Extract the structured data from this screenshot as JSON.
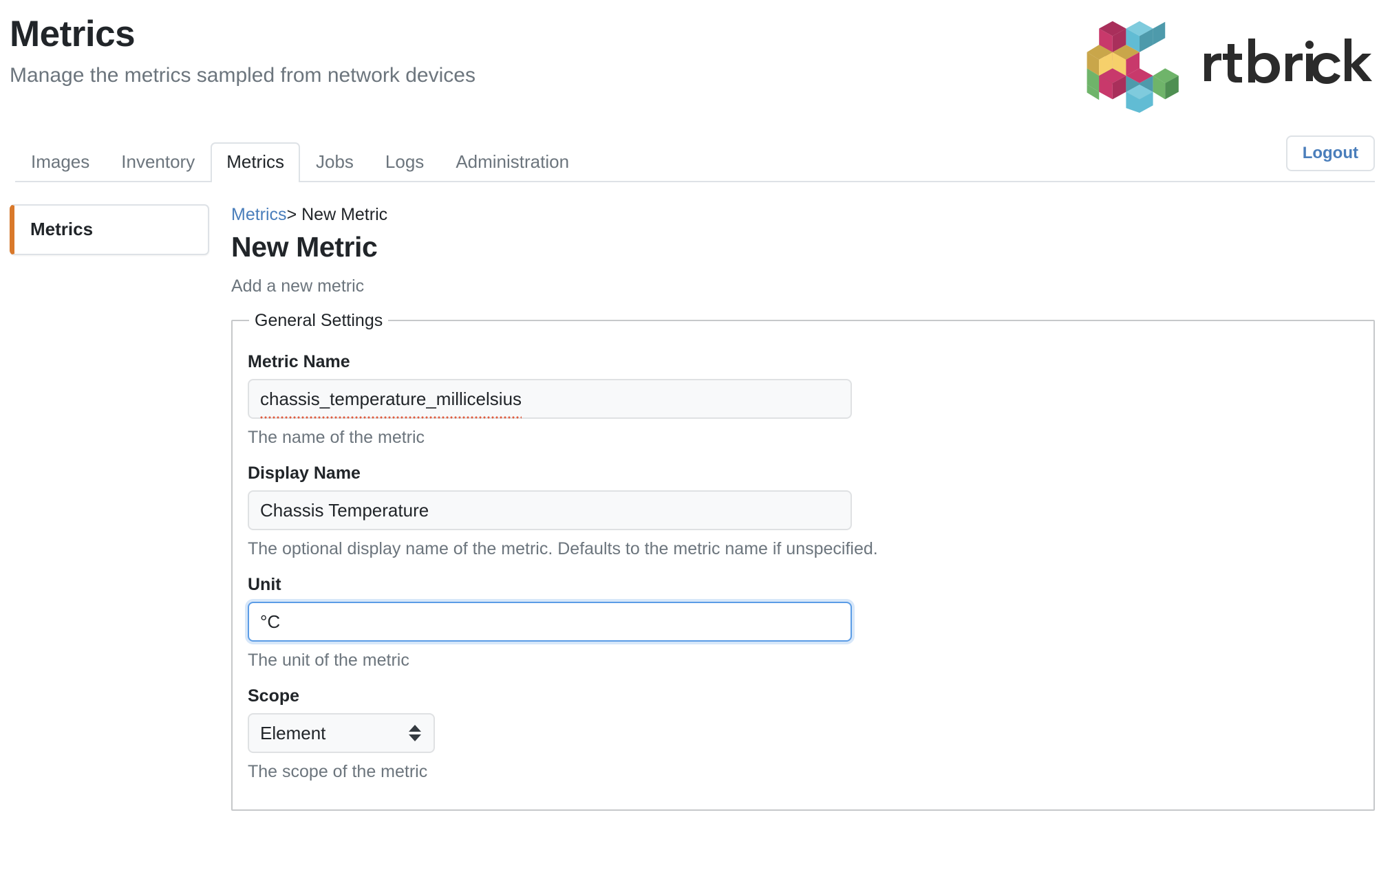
{
  "header": {
    "title": "Metrics",
    "subtitle": "Manage the metrics sampled from network devices",
    "brand_name": "rtbrick",
    "brand_colors": {
      "magenta": "#c8396b",
      "dark_magenta": "#a92f5b",
      "cyan": "#61bcd4",
      "teal": "#4e9aab",
      "gold": "#c9a64a",
      "yellow": "#f6d06b",
      "green": "#6fb46a",
      "dark_green": "#4e8f52",
      "wordmark": "#2b2b2b"
    }
  },
  "nav": {
    "tabs": [
      {
        "label": "Images",
        "active": false
      },
      {
        "label": "Inventory",
        "active": false
      },
      {
        "label": "Metrics",
        "active": true
      },
      {
        "label": "Jobs",
        "active": false
      },
      {
        "label": "Logs",
        "active": false
      },
      {
        "label": "Administration",
        "active": false
      }
    ],
    "logout_label": "Logout",
    "logout_color": "#4a7ebb"
  },
  "sidebar": {
    "items": [
      {
        "label": "Metrics",
        "active": true,
        "accent": "#d9792b"
      }
    ]
  },
  "breadcrumb": {
    "root_label": "Metrics",
    "separator": ">",
    "current_label": "New Metric"
  },
  "page": {
    "title": "New Metric",
    "description": "Add a new metric"
  },
  "form": {
    "legend": "General Settings",
    "fields": [
      {
        "id": "metric-name",
        "label": "Metric Name",
        "value": "chassis_temperature_millicelsius",
        "placeholder": "",
        "help": "The name of the metric",
        "type": "text",
        "focused": false,
        "spellcheck_error": true
      },
      {
        "id": "display-name",
        "label": "Display Name",
        "value": "Chassis Temperature",
        "placeholder": "",
        "help": "The optional display name of the metric. Defaults to the metric name if unspecified.",
        "type": "text",
        "focused": false,
        "spellcheck_error": false
      },
      {
        "id": "unit",
        "label": "Unit",
        "value": "°C",
        "placeholder": "",
        "help": "The unit of the metric",
        "type": "text",
        "focused": true,
        "spellcheck_error": false
      },
      {
        "id": "scope",
        "label": "Scope",
        "value": "Element",
        "help": "The scope of the metric",
        "type": "select",
        "focused": false,
        "options": [
          "Element"
        ]
      }
    ]
  }
}
